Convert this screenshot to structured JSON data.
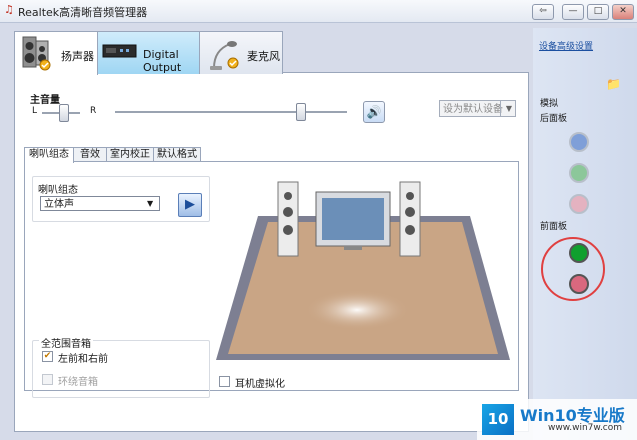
{
  "window": {
    "title": "Realtek高清晰音频管理器",
    "controls": [
      "⇦",
      "—",
      "□",
      "✕"
    ]
  },
  "device_tabs": [
    {
      "label": "扬声器",
      "icon": "speaker-icon",
      "active": true
    },
    {
      "label": "Digital Output",
      "icon": "digital-output-icon",
      "active": false
    },
    {
      "label": "麦克风",
      "icon": "microphone-icon",
      "active": false
    }
  ],
  "volume": {
    "label": "主音量",
    "left": "L",
    "right": "R",
    "default_device": "设为默认设备"
  },
  "sub_tabs": [
    "喇叭组态",
    "音效",
    "室内校正",
    "默认格式"
  ],
  "config": {
    "title": "喇叭组态",
    "selected": "立体声"
  },
  "fullrange": {
    "title": "全范围音箱",
    "front_lr": {
      "label": "左前和右前",
      "checked": true
    },
    "surround": {
      "label": "环绕音箱",
      "checked": false,
      "disabled": true
    }
  },
  "headphone_virtualization": {
    "label": "耳机虚拟化",
    "checked": false
  },
  "right_panel": {
    "device_advanced": "设备高级设置",
    "analog": "模拟",
    "back_panel": "后面板",
    "front_panel": "前面板",
    "colors": {
      "back_blue": "#7f9fd8",
      "back_green": "#8cc79a",
      "back_pink": "#e4b2c0",
      "front_green": "#10a02e",
      "front_pink": "#d9687e"
    }
  },
  "watermark": {
    "logo": "10",
    "brand": "Win10专业版",
    "url": "www.win7w.com"
  }
}
